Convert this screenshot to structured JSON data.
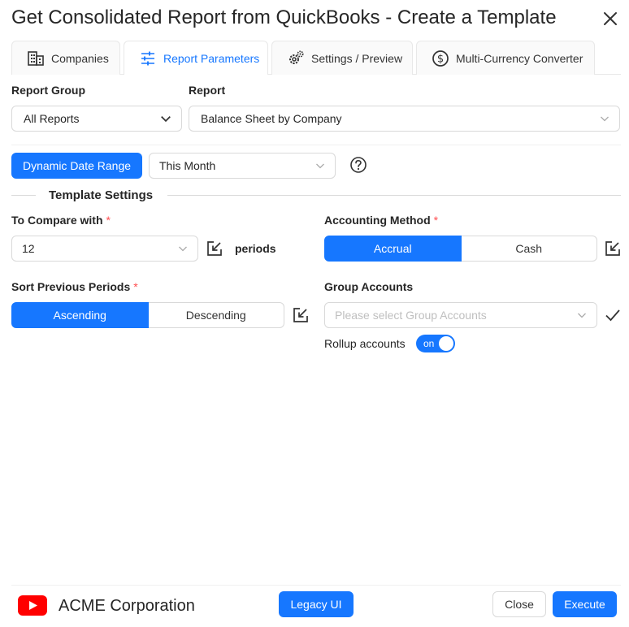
{
  "dialog": {
    "title": "Get Consolidated Report from QuickBooks - Create a Template"
  },
  "tabs": [
    {
      "label": "Companies",
      "icon": "building-icon",
      "active": false
    },
    {
      "label": "Report Parameters",
      "icon": "sliders-icon",
      "active": true
    },
    {
      "label": "Settings / Preview",
      "icon": "gears-icon",
      "active": false
    },
    {
      "label": "Multi-Currency Converter",
      "icon": "dollar-circle-icon",
      "active": false
    }
  ],
  "report_group": {
    "label": "Report Group",
    "value": "All Reports"
  },
  "report": {
    "label": "Report",
    "value": "Balance Sheet by Company"
  },
  "date_range": {
    "button_label": "Dynamic Date Range",
    "value": "This Month"
  },
  "template_settings": {
    "heading": "Template Settings"
  },
  "compare": {
    "label": "To Compare with",
    "required_mark": "*",
    "value": "12",
    "suffix": "periods"
  },
  "accounting_method": {
    "label": "Accounting Method",
    "required_mark": "*",
    "options": [
      "Accrual",
      "Cash"
    ],
    "selected": "Accrual"
  },
  "sort_periods": {
    "label": "Sort Previous Periods",
    "required_mark": "*",
    "options": [
      "Ascending",
      "Descending"
    ],
    "selected": "Ascending"
  },
  "group_accounts": {
    "label": "Group Accounts",
    "placeholder": "Please select Group Accounts"
  },
  "rollup": {
    "label": "Rollup accounts",
    "toggle_text": "on",
    "enabled": true
  },
  "footer": {
    "company": "ACME Corporation",
    "legacy_label": "Legacy UI",
    "close_label": "Close",
    "execute_label": "Execute"
  },
  "colors": {
    "primary": "#1677ff",
    "youtube_red": "#ff0000",
    "required": "#ff4d4f"
  }
}
